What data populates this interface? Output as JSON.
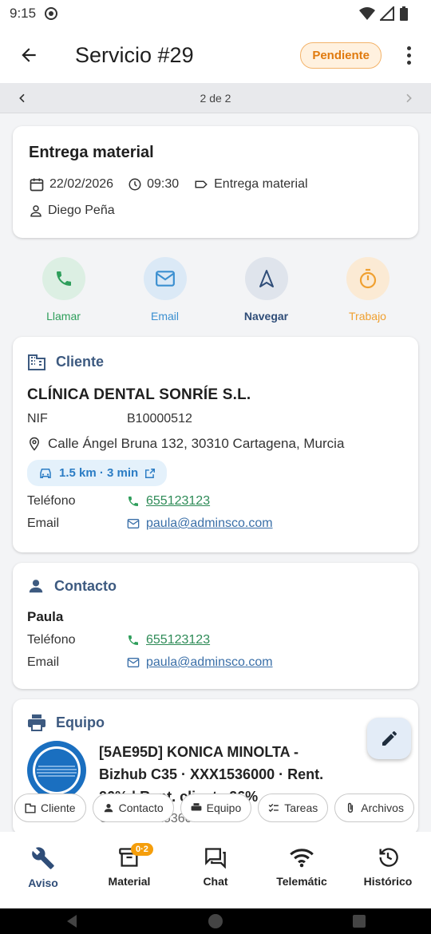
{
  "status": {
    "time": "9:15"
  },
  "appbar": {
    "title": "Servicio #29",
    "badge": "Pendiente"
  },
  "pager": {
    "label": "2 de 2"
  },
  "summary": {
    "title": "Entrega material",
    "date": "22/02/2026",
    "time": "09:30",
    "type": "Entrega material",
    "person": "Diego Peña"
  },
  "actions": [
    {
      "label": "Llamar",
      "color": "#2e9e5b"
    },
    {
      "label": "Email",
      "color": "#3b8fd0"
    },
    {
      "label": "Navegar",
      "color": "#2f4d78"
    },
    {
      "label": "Trabajo",
      "color": "#f0a030"
    }
  ],
  "client": {
    "section": "Cliente",
    "name": "CLÍNICA DENTAL SONRÍE S.L.",
    "nif_label": "NIF",
    "nif": "B10000512",
    "address": "Calle Ángel Bruna 132, 30310 Cartagena, Murcia",
    "route": "1.5 km · 3 min",
    "phone_label": "Teléfono",
    "phone": "655123123",
    "email_label": "Email",
    "email": "paula@adminsco.com"
  },
  "contact": {
    "section": "Contacto",
    "name": "Paula",
    "phone_label": "Teléfono",
    "phone": "655123123",
    "email_label": "Email",
    "email": "paula@adminsco.com"
  },
  "equipment": {
    "section": "Equipo",
    "line1": "[5AE95D] KONICA MINOLTA -",
    "line2": "Bizhub C35 · XXX1536000 · Rent.",
    "line3": "26% | Rent. cliente 26%",
    "line4": "C-XXXXXX536000"
  },
  "filter_chips": [
    "Cliente",
    "Contacto",
    "Equipo",
    "Tareas",
    "Archivos"
  ],
  "bottom_nav": [
    {
      "label": "Aviso"
    },
    {
      "label": "Material",
      "badge": "0·2"
    },
    {
      "label": "Chat"
    },
    {
      "label": "Telemátic"
    },
    {
      "label": "Histórico"
    }
  ]
}
